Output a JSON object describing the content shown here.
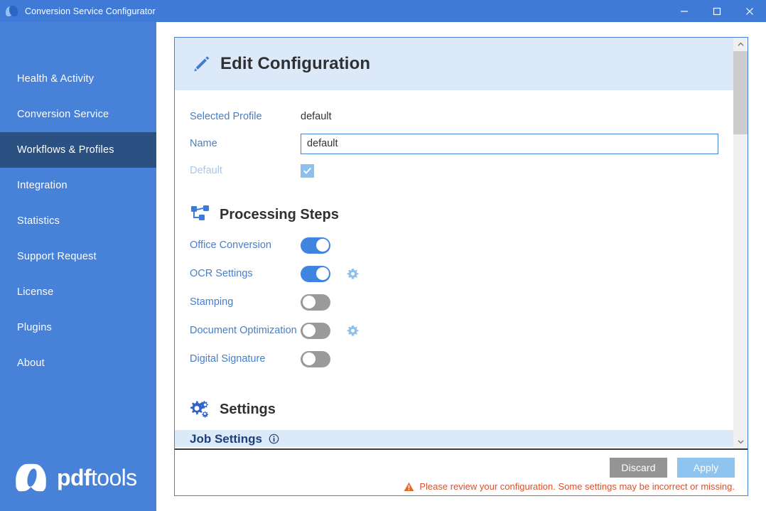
{
  "window": {
    "title": "Conversion Service Configurator",
    "logo_icon": "pdftools-logo-icon",
    "controls": {
      "minimize": "minimize-icon",
      "maximize": "maximize-icon",
      "close": "close-icon"
    }
  },
  "sidebar": {
    "items": [
      {
        "label": "Health & Activity",
        "active": false
      },
      {
        "label": "Conversion Service",
        "active": false
      },
      {
        "label": "Workflows & Profiles",
        "active": true
      },
      {
        "label": "Integration",
        "active": false
      },
      {
        "label": "Statistics",
        "active": false
      },
      {
        "label": "Support Request",
        "active": false
      },
      {
        "label": "License",
        "active": false
      },
      {
        "label": "Plugins",
        "active": false
      },
      {
        "label": "About",
        "active": false
      }
    ],
    "brand": {
      "bold": "pdf",
      "regular": "tools",
      "icon": "pdftools-logo-icon"
    },
    "colors": {
      "background": "#4781d8",
      "active_background": "#2b5183",
      "text": "#ffffff"
    }
  },
  "panel": {
    "header": {
      "title": "Edit Configuration",
      "icon": "pencil-icon",
      "background": "#dce9f9"
    },
    "fields": [
      {
        "label": "Selected Profile",
        "type": "readonly-text",
        "value": "default"
      },
      {
        "label": "Name",
        "type": "text-input",
        "value": "default",
        "placeholder": "Name"
      },
      {
        "label": "Default",
        "type": "checkbox",
        "checked": true,
        "disabled": true,
        "check_glyph": "check-icon"
      }
    ],
    "processing_steps": {
      "title": "Processing Steps",
      "icon": "workflow-icon",
      "steps": [
        {
          "label": "Office Conversion",
          "enabled": true,
          "has_settings": false
        },
        {
          "label": "OCR Settings",
          "enabled": true,
          "has_settings": true
        },
        {
          "label": "Stamping",
          "enabled": false,
          "has_settings": false
        },
        {
          "label": "Document Optimization",
          "enabled": false,
          "has_settings": true
        },
        {
          "label": "Digital Signature",
          "enabled": false,
          "has_settings": false
        }
      ],
      "settings_icon": "gear-icon"
    },
    "settings_section": {
      "title": "Settings",
      "icon": "gears-icon"
    },
    "job_settings": {
      "title": "Job Settings",
      "info_icon": "info-icon"
    },
    "scrollbar": {
      "up_icon": "chevron-up-icon",
      "down_icon": "chevron-down-icon"
    },
    "footer": {
      "discard_label": "Discard",
      "apply_label": "Apply",
      "warning_text": "Please review your configuration. Some settings may be incorrect or missing.",
      "warning_icon": "warning-triangle-icon",
      "warning_color": "#d9512c",
      "discard_color": "#949494",
      "apply_color": "#8ec5f0"
    }
  }
}
